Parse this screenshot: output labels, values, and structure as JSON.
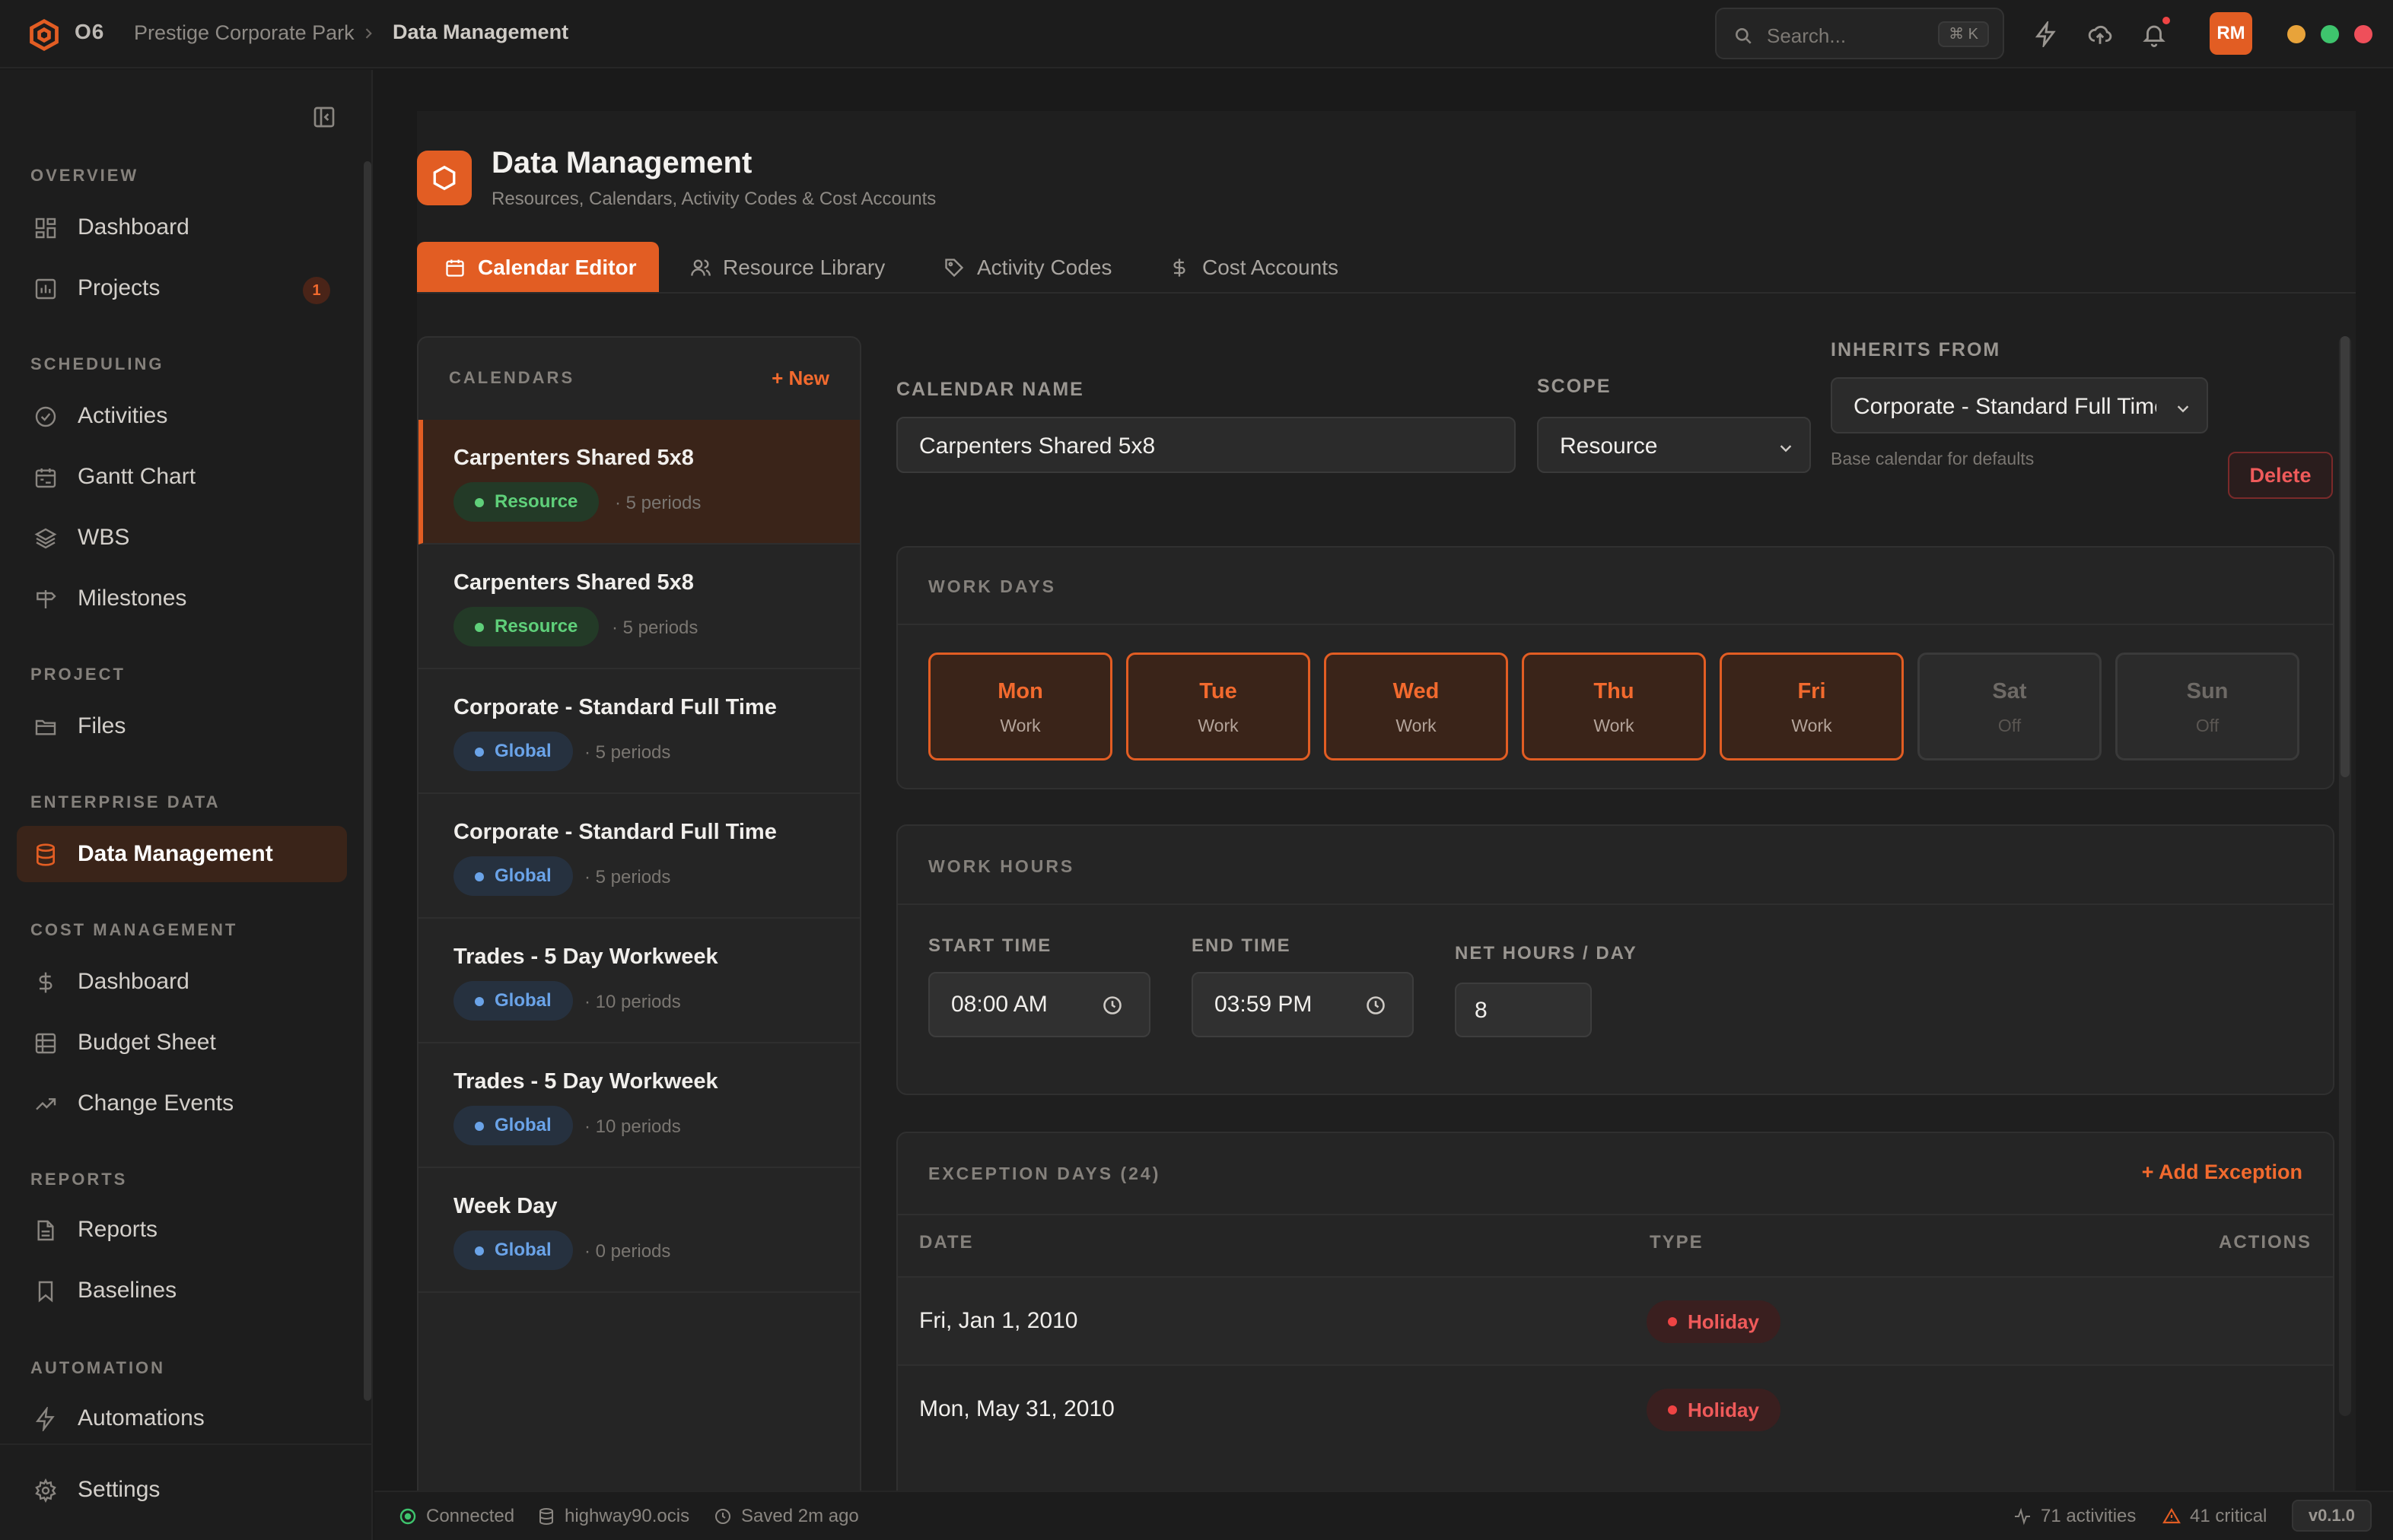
{
  "topbar": {
    "org": "O6",
    "breadcrumb": {
      "project": "Prestige Corporate Park",
      "current": "Data Management"
    },
    "search": {
      "placeholder": "Search...",
      "shortcut": "⌘ K"
    },
    "icons": [
      "bolt-icon",
      "cloud-upload-icon",
      "bell-icon"
    ],
    "avatar_initials": "RM",
    "window_controls": [
      "#e8a33a",
      "#3ec46d",
      "#ef4f5a"
    ]
  },
  "sidebar": {
    "sections": {
      "overview": "OVERVIEW",
      "scheduling": "SCHEDULING",
      "project": "PROJECT",
      "enterprise": "ENTERPRISE DATA",
      "cost": "COST MANAGEMENT",
      "reports": "REPORTS",
      "automation": "AUTOMATION"
    },
    "items": {
      "dashboard": "Dashboard",
      "projects": "Projects",
      "projects_badge": "1",
      "activities": "Activities",
      "gantt": "Gantt Chart",
      "wbs": "WBS",
      "milestones": "Milestones",
      "files": "Files",
      "data_management": "Data Management",
      "cost_dashboard": "Dashboard",
      "budget_sheet": "Budget Sheet",
      "change_events": "Change Events",
      "reports": "Reports",
      "baselines": "Baselines",
      "automations": "Automations",
      "settings": "Settings"
    }
  },
  "header": {
    "title": "Data Management",
    "subtitle": "Resources, Calendars, Activity Codes & Cost Accounts"
  },
  "tabs": {
    "calendar_editor": "Calendar Editor",
    "resource_library": "Resource Library",
    "activity_codes": "Activity Codes",
    "cost_accounts": "Cost Accounts"
  },
  "calendars": {
    "heading": "CALENDARS",
    "new_label": "+ New",
    "items": [
      {
        "name": "Carpenters Shared 5x8",
        "scope": "Resource",
        "periods": "· 5 periods"
      },
      {
        "name": "Carpenters Shared 5x8",
        "scope": "Resource",
        "periods": "· 5 periods"
      },
      {
        "name": "Corporate - Standard Full Time",
        "scope": "Global",
        "periods": "· 5 periods"
      },
      {
        "name": "Corporate - Standard Full Time",
        "scope": "Global",
        "periods": "· 5 periods"
      },
      {
        "name": "Trades - 5 Day Workweek",
        "scope": "Global",
        "periods": "· 10 periods"
      },
      {
        "name": "Trades - 5 Day Workweek",
        "scope": "Global",
        "periods": "· 10 periods"
      },
      {
        "name": "Week Day",
        "scope": "Global",
        "periods": "· 0 periods"
      }
    ]
  },
  "editor": {
    "calendar_name_label": "CALENDAR NAME",
    "calendar_name_value": "Carpenters Shared 5x8",
    "scope_label": "SCOPE",
    "scope_value": "Resource",
    "inherits_label": "INHERITS FROM",
    "inherits_value": "Corporate - Standard Full Time",
    "inherits_help": "Base calendar for defaults",
    "delete_label": "Delete"
  },
  "work_days": {
    "heading": "WORK DAYS",
    "days": [
      {
        "name": "Mon",
        "state": "Work"
      },
      {
        "name": "Tue",
        "state": "Work"
      },
      {
        "name": "Wed",
        "state": "Work"
      },
      {
        "name": "Thu",
        "state": "Work"
      },
      {
        "name": "Fri",
        "state": "Work"
      },
      {
        "name": "Sat",
        "state": "Off"
      },
      {
        "name": "Sun",
        "state": "Off"
      }
    ]
  },
  "work_hours": {
    "heading": "WORK HOURS",
    "start_label": "START TIME",
    "start_value": "08:00 AM",
    "end_label": "END TIME",
    "end_value": "03:59 PM",
    "net_label": "NET HOURS / DAY",
    "net_value": "8"
  },
  "exceptions": {
    "heading": "EXCEPTION DAYS (24)",
    "add_label": "+ Add Exception",
    "columns": {
      "date": "DATE",
      "type": "TYPE",
      "actions": "ACTIONS"
    },
    "rows": [
      {
        "date": "Fri, Jan 1, 2010",
        "type": "Holiday"
      },
      {
        "date": "Mon, May 31, 2010",
        "type": "Holiday"
      }
    ]
  },
  "statusbar": {
    "connected": "Connected",
    "file": "highway90.ocis",
    "saved": "Saved 2m ago",
    "activities": "71 activities",
    "critical": "41 critical",
    "version": "v0.1.0"
  },
  "colors": {
    "accent": "#e25d23",
    "resource_pill": "#5fd07a",
    "global_pill": "#6aa3e8",
    "holiday": "#ef5a5a"
  }
}
